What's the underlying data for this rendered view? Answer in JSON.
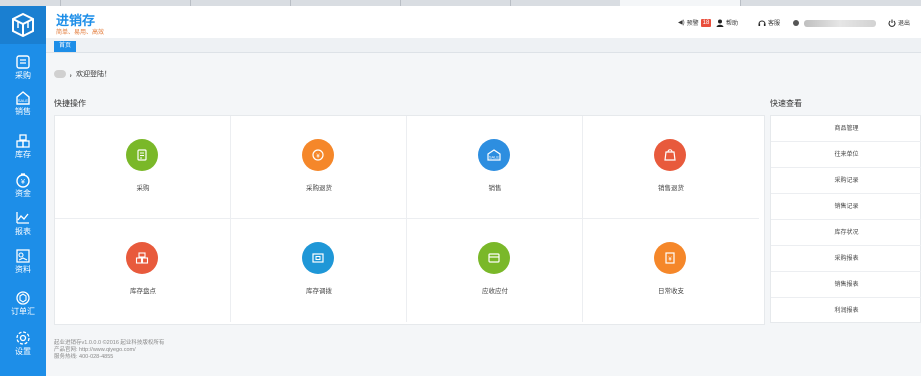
{
  "app": {
    "title": "进销存",
    "subtitle": "简单、易用、高效"
  },
  "header": {
    "alert_label": "预警",
    "alert_count": "18",
    "help_label": "帮助",
    "service_label": "客服",
    "logout_label": "退出"
  },
  "tabs": {
    "home_label": "首页"
  },
  "welcome": {
    "text": "，欢迎登陆！"
  },
  "sidebar": {
    "items": [
      {
        "label": "采购",
        "icon": "purchase-icon"
      },
      {
        "label": "销售",
        "icon": "sale-icon"
      },
      {
        "label": "库存",
        "icon": "inventory-icon"
      },
      {
        "label": "资金",
        "icon": "money-icon"
      },
      {
        "label": "报表",
        "icon": "report-icon"
      },
      {
        "label": "资料",
        "icon": "data-icon"
      },
      {
        "label": "订单汇",
        "icon": "order-icon"
      },
      {
        "label": "设置",
        "icon": "settings-icon"
      }
    ]
  },
  "quick_ops": {
    "title": "快捷操作",
    "items": [
      {
        "label": "采购",
        "color": "#7ab829",
        "icon": "purchase-doc-icon"
      },
      {
        "label": "采购退货",
        "color": "#f5872a",
        "icon": "purchase-return-icon"
      },
      {
        "label": "销售",
        "color": "#2d8ee0",
        "icon": "sale-tag-icon"
      },
      {
        "label": "销售退货",
        "color": "#e85a3c",
        "icon": "sale-return-icon"
      },
      {
        "label": "库存盘点",
        "color": "#e85a3c",
        "icon": "stocktake-icon"
      },
      {
        "label": "库存调拨",
        "color": "#1f97d7",
        "icon": "transfer-icon"
      },
      {
        "label": "应收应付",
        "color": "#7ab829",
        "icon": "receivable-icon"
      },
      {
        "label": "日常收支",
        "color": "#f5872a",
        "icon": "daily-cash-icon"
      }
    ]
  },
  "quick_view": {
    "title": "快速查看",
    "items": [
      "商品管理",
      "往来单位",
      "采购记录",
      "销售记录",
      "库存状况",
      "采购报表",
      "销售报表",
      "利润报表"
    ]
  },
  "footer": {
    "line1": "起业进销存v1.0.0.0  ©2016 起业科技版权所有",
    "line2": "产品官网: http://www.qiyego.com/",
    "line3": "服务热线: 400-028-4855"
  },
  "colors": {
    "sidebar": "#1d8ee8",
    "accent": "#1d8ee8",
    "subtitle": "#e37b3a"
  }
}
